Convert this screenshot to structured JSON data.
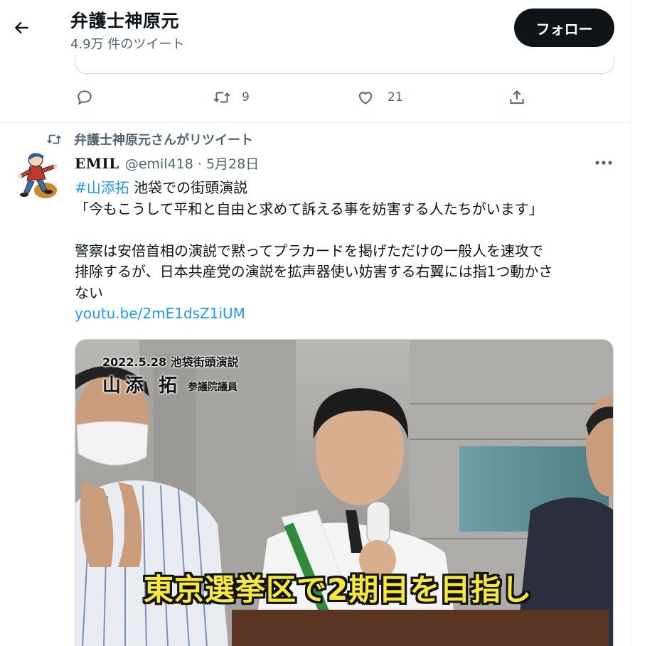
{
  "header": {
    "title": "弁護士神原元",
    "tweet_count": "4.9万 件のツイート",
    "follow_label": "フォロー"
  },
  "prev_tweet": {
    "retweets": "9",
    "likes": "21"
  },
  "retweet_banner": "弁護士神原元さんがリツイート",
  "tweet": {
    "author_name": "EMIL",
    "handle_date": "@emil418 · 5月28日",
    "hashtag": "#山添拓",
    "line1_rest": " 池袋での街頭演説",
    "line2": "「今もこうして平和と自由と求めて訴える事を妨害する人たちがいます」",
    "line3": "警察は安倍首相の演説で黙ってプラカードを掲げただけの一般人を速攻で",
    "line4": "排除するが、日本共産党の演説を拡声器使い妨害する右翼には指1つ動かさ",
    "line5": "ない",
    "link": "youtu.be/2mE1dsZ1iUM"
  },
  "video": {
    "caption_date": "2022.5.28 池袋街頭演説",
    "caption_name": "山添 拓",
    "caption_role": "参議院議員",
    "subtitle": "東京選挙区で2期目を目指し"
  },
  "icons": [
    "back-arrow-icon",
    "reply-icon",
    "retweet-icon",
    "like-icon",
    "share-icon",
    "more-icon"
  ],
  "colors": {
    "accent": "#1d9bf0",
    "text": "#0f1419",
    "muted": "#536471",
    "subtitle": "#f7e93b"
  }
}
